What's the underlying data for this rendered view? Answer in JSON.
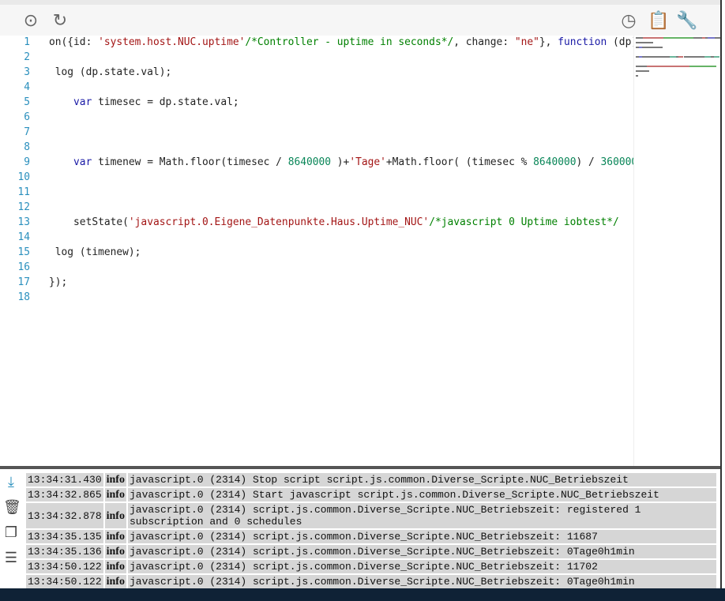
{
  "toolbar": {
    "left_icons": [
      "locate-icon",
      "reload-icon"
    ],
    "right_icons": [
      "clock-icon",
      "clipboard-icon",
      "wrench-icon"
    ]
  },
  "editor": {
    "lines": [
      [
        [
          "on({id: ",
          ""
        ],
        [
          "'system.host.NUC.uptime'",
          "str"
        ],
        [
          "/*Controller - uptime in seconds*/",
          "cm"
        ],
        [
          ", change: ",
          ""
        ],
        [
          "\"ne\"",
          "str"
        ],
        [
          "}, ",
          ""
        ],
        [
          "function",
          "kw"
        ],
        [
          " (dp) {",
          ""
        ]
      ],
      [],
      [
        [
          " log (dp.state.val);",
          ""
        ]
      ],
      [],
      [
        [
          "    ",
          ""
        ],
        [
          "var",
          "kw"
        ],
        [
          " timesec = dp.state.val;",
          ""
        ]
      ],
      [],
      [],
      [],
      [
        [
          "    ",
          ""
        ],
        [
          "var",
          "kw"
        ],
        [
          " timenew = Math.floor(timesec / ",
          ""
        ],
        [
          "8640000",
          "num"
        ],
        [
          " )+",
          ""
        ],
        [
          "'Tage'",
          "str"
        ],
        [
          "+Math.floor( (timesec % ",
          ""
        ],
        [
          "8640000",
          "num"
        ],
        [
          ") / ",
          ""
        ],
        [
          "360000",
          "num"
        ]
      ],
      [],
      [],
      [],
      [
        [
          "    setState(",
          ""
        ],
        [
          "'javascript.0.Eigene_Datenpunkte.Haus.Uptime_NUC'",
          "str"
        ],
        [
          "/*javascript 0 Uptime iobtest*/",
          "cm"
        ]
      ],
      [],
      [
        [
          " log (timenew);",
          ""
        ]
      ],
      [],
      [
        [
          "});",
          ""
        ]
      ],
      []
    ]
  },
  "log": {
    "side_icons": [
      "scroll-down-icon",
      "delete-icon",
      "copy-icon",
      "layout-icon"
    ],
    "rows": [
      {
        "time": "13:34:31.430",
        "severity": "info",
        "message": "javascript.0 (2314) Stop script script.js.common.Diverse_Scripte.NUC_Betriebszeit"
      },
      {
        "time": "13:34:32.865",
        "severity": "info",
        "message": "javascript.0 (2314) Start javascript script.js.common.Diverse_Scripte.NUC_Betriebszeit"
      },
      {
        "time": "13:34:32.878",
        "severity": "info",
        "message": "javascript.0 (2314) script.js.common.Diverse_Scripte.NUC_Betriebszeit: registered 1 subscription and 0 schedules"
      },
      {
        "time": "13:34:35.135",
        "severity": "info",
        "message": "javascript.0 (2314) script.js.common.Diverse_Scripte.NUC_Betriebszeit: 11687"
      },
      {
        "time": "13:34:35.136",
        "severity": "info",
        "message": "javascript.0 (2314) script.js.common.Diverse_Scripte.NUC_Betriebszeit: 0Tage0h1min"
      },
      {
        "time": "13:34:50.122",
        "severity": "info",
        "message": "javascript.0 (2314) script.js.common.Diverse_Scripte.NUC_Betriebszeit: 11702"
      },
      {
        "time": "13:34:50.122",
        "severity": "info",
        "message": "javascript.0 (2314) script.js.common.Diverse_Scripte.NUC_Betriebszeit: 0Tage0h1min"
      }
    ]
  }
}
